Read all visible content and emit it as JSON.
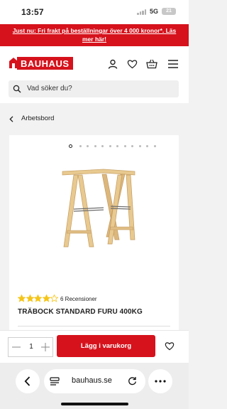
{
  "status_bar": {
    "time": "13:57",
    "network": "5G",
    "battery": "21"
  },
  "promo_banner": {
    "text": "Just nu: Fri frakt på beställningar över 4 000 kronor*. Läs mer här!"
  },
  "header": {
    "logo_text": "BAUHAUS",
    "icons": [
      "user-icon",
      "heart-icon",
      "basket-icon",
      "menu-icon"
    ]
  },
  "search": {
    "placeholder": "Vad söker du?"
  },
  "breadcrumb": {
    "back_label": "Arbetsbord"
  },
  "product": {
    "image_count": 12,
    "active_image": 0,
    "rating": 4,
    "rating_max": 5,
    "reviews_label": "6 Recensioner",
    "title": "TRÄBOCK STANDARD FURU 400KG"
  },
  "buy_bar": {
    "quantity": "1",
    "add_to_cart_label": "Lägg i varukorg"
  },
  "browser": {
    "domain": "bauhaus.se"
  },
  "colors": {
    "brand_red": "#d6121c",
    "star_yellow": "#f5c518"
  }
}
